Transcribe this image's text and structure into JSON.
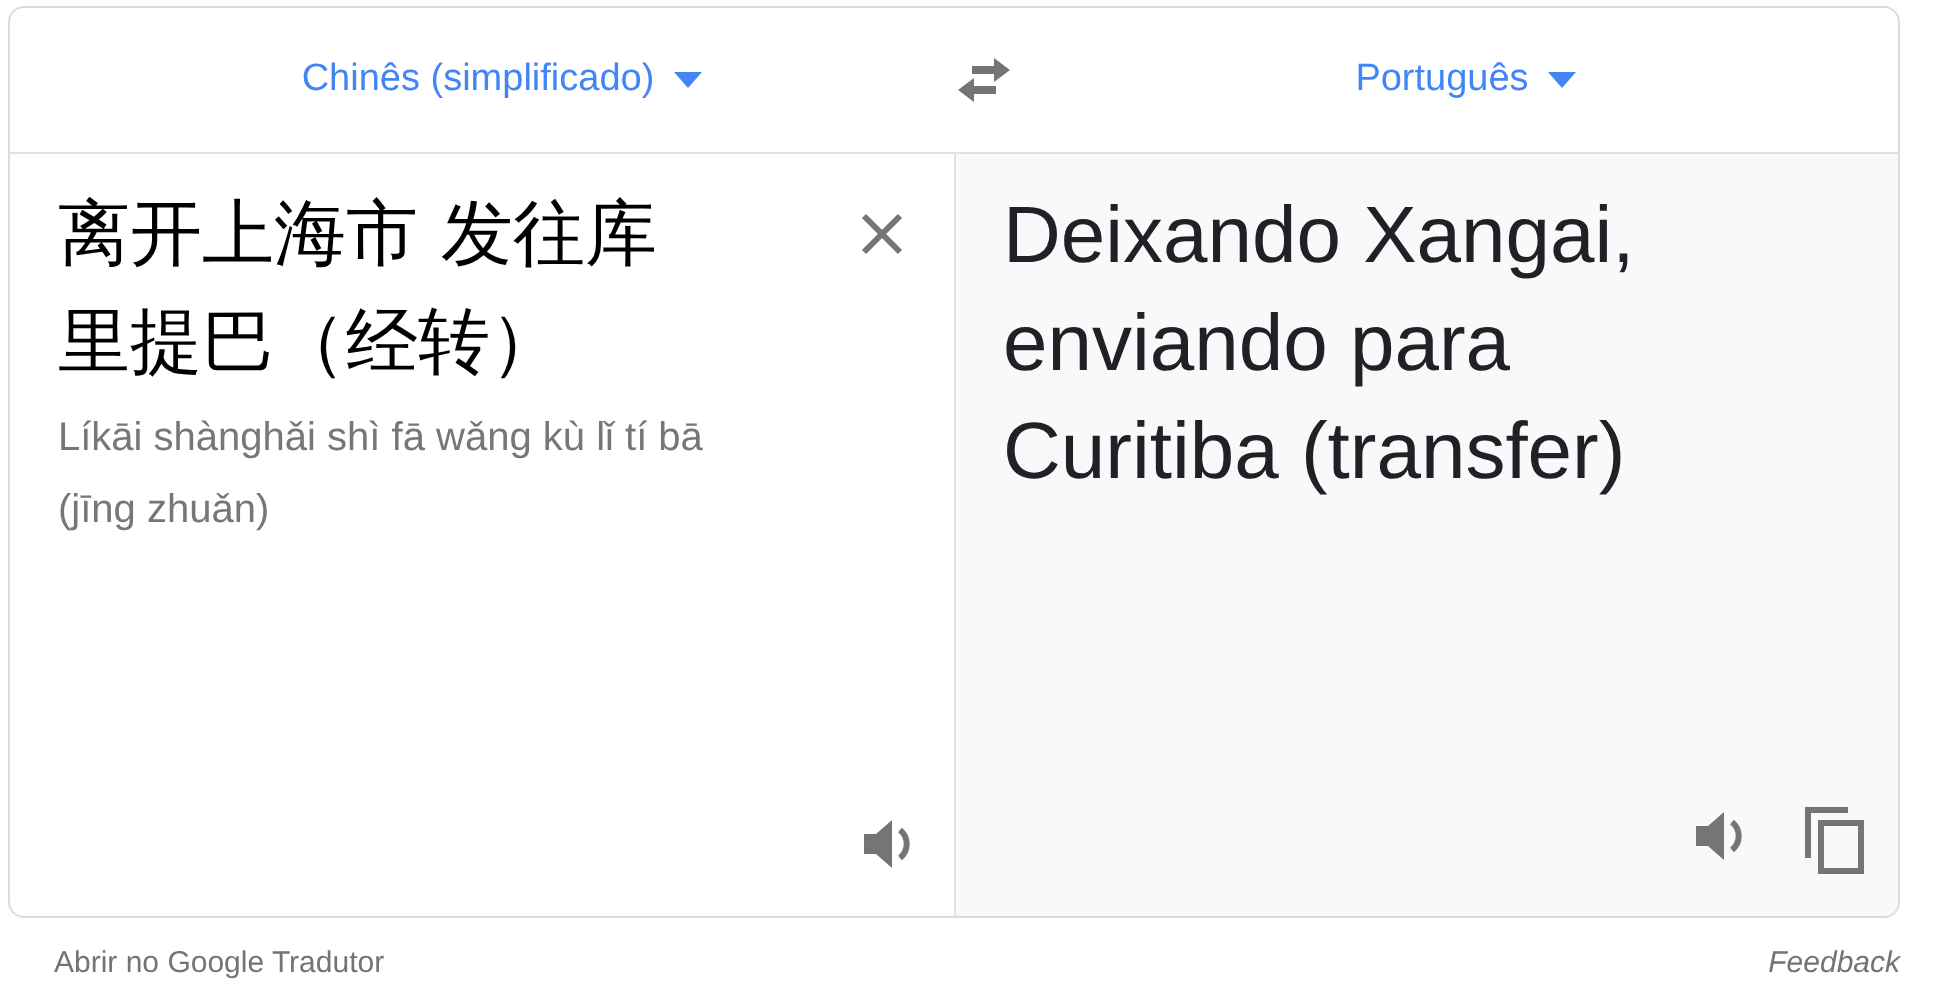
{
  "source_language": {
    "label": "Chinês (simplificado)"
  },
  "target_language": {
    "label": "Português"
  },
  "source": {
    "text": "离开上海市 发往库里提巴（经转）",
    "romanization": "Líkāi shànghǎi shì fā wǎng kù lǐ tí bā (jīng zhuǎn)"
  },
  "translation": {
    "text": "Deixando Xangai, enviando para Curitiba (transfer)"
  },
  "footer": {
    "open_link": "Abrir no Google Tradutor",
    "feedback": "Feedback"
  }
}
